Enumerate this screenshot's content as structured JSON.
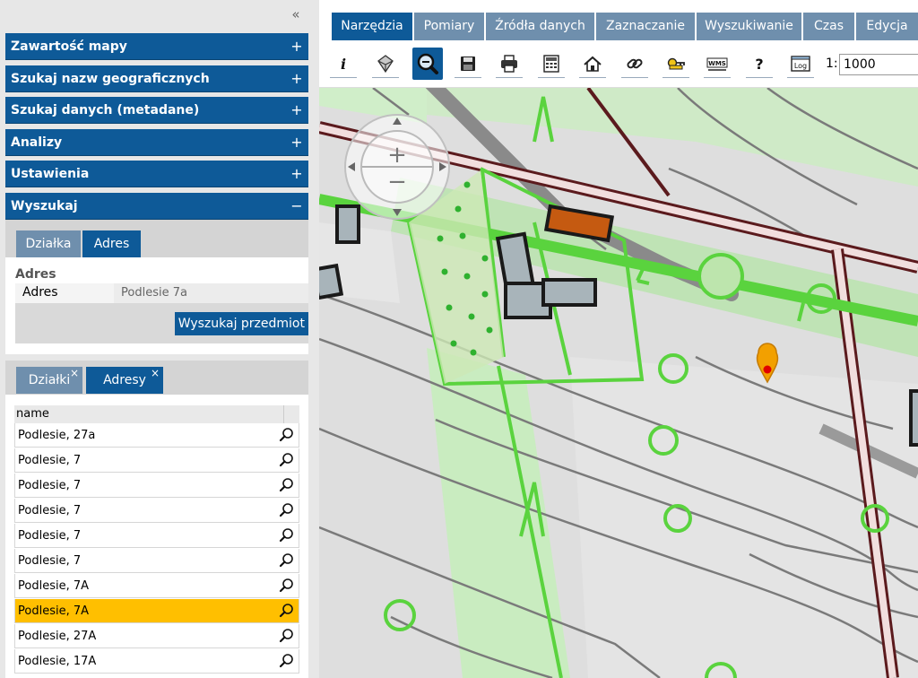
{
  "left": {
    "collapse_icon": "«",
    "accordion": [
      {
        "label": "Zawartość mapy",
        "state": "+"
      },
      {
        "label": "Szukaj nazw geograficznych",
        "state": "+"
      },
      {
        "label": "Szukaj danych (metadane)",
        "state": "+"
      },
      {
        "label": "Analizy",
        "state": "+"
      },
      {
        "label": "Ustawienia",
        "state": "+"
      },
      {
        "label": "Wyszukaj",
        "state": "−"
      }
    ],
    "search": {
      "tabs": [
        "Działka",
        "Adres"
      ],
      "active_tab": "Adres",
      "fieldset_label": "Adres",
      "field_label": "Adres",
      "field_value": "Podlesie 7a",
      "button_label": "Wyszukaj przedmiot"
    },
    "results": {
      "tabs": [
        "Działki",
        "Adresy"
      ],
      "active_tab": "Adresy",
      "close_icon": "×",
      "column": "name",
      "rows": [
        {
          "name": "Podlesie, 27a",
          "selected": false
        },
        {
          "name": "Podlesie, 7",
          "selected": false
        },
        {
          "name": "Podlesie, 7",
          "selected": false
        },
        {
          "name": "Podlesie, 7",
          "selected": false
        },
        {
          "name": "Podlesie, 7",
          "selected": false
        },
        {
          "name": "Podlesie, 7",
          "selected": false
        },
        {
          "name": "Podlesie, 7A",
          "selected": false
        },
        {
          "name": "Podlesie, 7A",
          "selected": true
        },
        {
          "name": "Podlesie, 27A",
          "selected": false
        },
        {
          "name": "Podlesie, 17A",
          "selected": false
        }
      ]
    }
  },
  "toolbar": {
    "tabs": [
      "Narzędzia",
      "Pomiary",
      "Źródła danych",
      "Zaznaczanie",
      "Wyszukiwanie",
      "Czas",
      "Edycja"
    ],
    "active_tab": "Narzędzia",
    "tools": [
      "info-icon",
      "measure-3d-icon",
      "zoom-magnifier-icon",
      "save-icon",
      "print-icon",
      "calculator-icon",
      "home-icon",
      "link-icon",
      "key-icon",
      "wms-icon",
      "help-icon",
      "log-icon"
    ],
    "wms_text": "WMS",
    "help_text": "?",
    "info_text": "i",
    "log_text": "Log",
    "active_tool": "zoom-magnifier-icon",
    "scale_label": "1:",
    "scale_value": "1000"
  },
  "map": {
    "zoom_in": "+",
    "zoom_out": "−"
  },
  "colors": {
    "accent": "#0e5a98",
    "tab_inactive": "#6f8fad",
    "selected_row": "#ffbf00",
    "parcel_green": "#5ad33e",
    "road_border": "#5b1a1d",
    "marker_orange": "#f2a000",
    "marker_red": "#e00000"
  }
}
